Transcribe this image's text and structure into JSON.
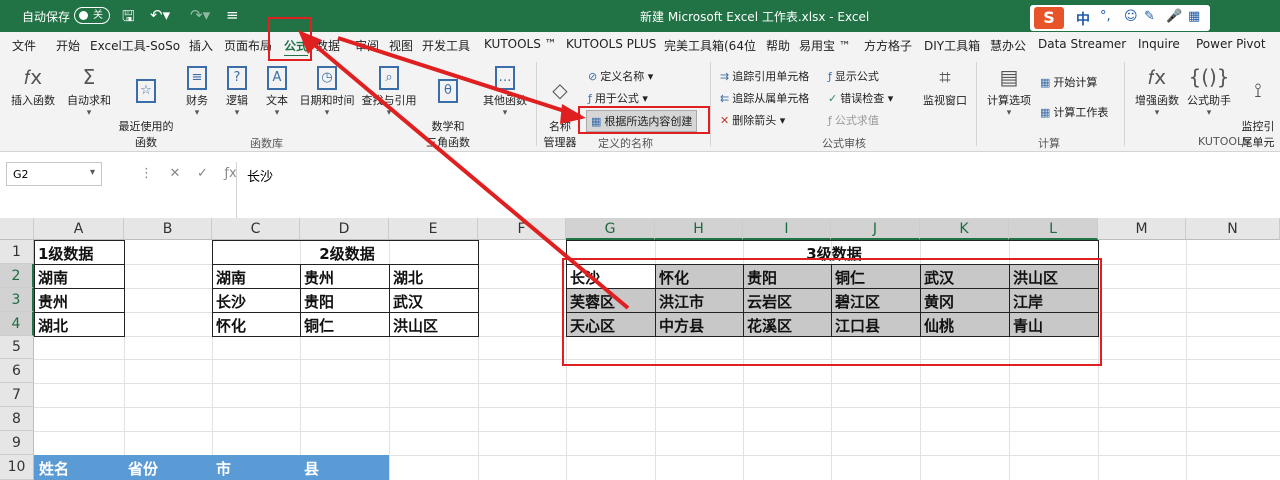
{
  "titlebar": {
    "autosave": "自动保存",
    "toggle": "关",
    "title": "新建 Microsoft Excel 工作表.xlsx  -  Excel",
    "ime_logo": "S",
    "ime_lang": "中"
  },
  "tabs": [
    "文件",
    "开始",
    "Excel工具-SoSo",
    "插入",
    "页面布局",
    "公式",
    "数据",
    "审阅",
    "视图",
    "开发工具",
    "KUTOOLS ™",
    "KUTOOLS PLUS",
    "完美工具箱(64位",
    "帮助",
    "易用宝 ™",
    "方方格子",
    "DIY工具箱",
    "慧办公",
    "Data Streamer",
    "Inquire",
    "Power Pivot"
  ],
  "ribbon": {
    "insert_function": "插入函数",
    "autosum": "自动求和",
    "recent": "最近使用的\n函数",
    "financial": "财务",
    "logical": "逻辑",
    "text": "文本",
    "datetime": "日期和时间",
    "lookup": "查找与引用",
    "math": "数学和\n三角函数",
    "other": "其他函数",
    "function_library": "函数库",
    "name_manager": "名称\n管理器",
    "define_name": "定义名称",
    "use_in_formula": "用于公式",
    "create_from_selection": "根据所选内容创建",
    "defined_names": "定义的名称",
    "trace_precedents": "追踪引用单元格",
    "trace_dependents": "追踪从属单元格",
    "remove_arrows": "删除箭头",
    "show_formulas": "显示公式",
    "error_checking": "错误检查",
    "evaluate_formula": "公式求值",
    "watch_window": "监视窗口",
    "formula_auditing": "公式审核",
    "calc_options": "计算选项",
    "calc_now": "开始计算",
    "calc_sheet": "计算工作表",
    "calculation": "计算",
    "enhanced_func": "增强函数",
    "formula_helper": "公式助手",
    "monitor": "监控引\n尾单元",
    "kutools": "KUTOOLS"
  },
  "formula_bar": {
    "name_box": "G2",
    "content": "长沙"
  },
  "grid": {
    "columns": [
      "A",
      "B",
      "C",
      "D",
      "E",
      "F",
      "G",
      "H",
      "I",
      "J",
      "K",
      "L",
      "M",
      "N"
    ],
    "rows": [
      "1",
      "2",
      "3",
      "4",
      "5",
      "6",
      "7",
      "8",
      "9",
      "10"
    ],
    "a": {
      "title": "1级数据",
      "v": [
        "湖南",
        "贵州",
        "湖北"
      ]
    },
    "cde": {
      "title": "2级数据",
      "r2": [
        "湖南",
        "贵州",
        "湖北"
      ],
      "r3": [
        "长沙",
        "贵阳",
        "武汉"
      ],
      "r4": [
        "怀化",
        "铜仁",
        "洪山区"
      ]
    },
    "gl": {
      "title": "3级数据",
      "r2": [
        "长沙",
        "怀化",
        "贵阳",
        "铜仁",
        "武汉",
        "洪山区"
      ],
      "r3": [
        "芙蓉区",
        "洪江市",
        "云岩区",
        "碧江区",
        "黄冈",
        "江岸"
      ],
      "r4": [
        "天心区",
        "中方县",
        "花溪区",
        "江口县",
        "仙桃",
        "青山"
      ]
    },
    "r10": [
      "姓名",
      "省份",
      "市",
      "县"
    ]
  }
}
